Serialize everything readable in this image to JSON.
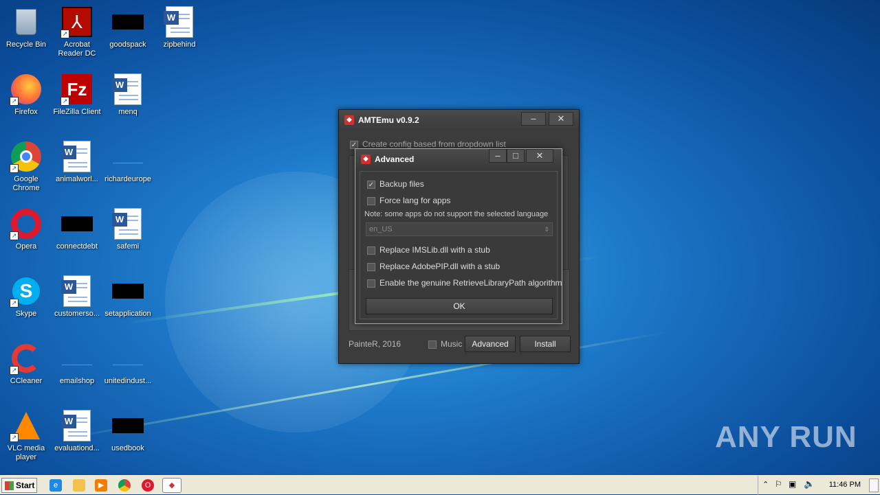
{
  "desktop": {
    "icons": [
      {
        "label": "Recycle Bin"
      },
      {
        "label": "Acrobat Reader DC"
      },
      {
        "label": "goodspack"
      },
      {
        "label": "zipbehind"
      },
      {
        "label": "Firefox"
      },
      {
        "label": "FileZilla Client"
      },
      {
        "label": "menq"
      },
      {
        "label": "Google Chrome"
      },
      {
        "label": "animalworl..."
      },
      {
        "label": "richardeurope"
      },
      {
        "label": "Opera"
      },
      {
        "label": "connectdebt"
      },
      {
        "label": "safemi"
      },
      {
        "label": "Skype"
      },
      {
        "label": "customerso..."
      },
      {
        "label": "setapplication"
      },
      {
        "label": "CCleaner"
      },
      {
        "label": "emailshop"
      },
      {
        "label": "unitedindust..."
      },
      {
        "label": "VLC media player"
      },
      {
        "label": "evaluationd..."
      },
      {
        "label": "usedbook"
      }
    ],
    "watermark": "ANY RUN"
  },
  "main_window": {
    "title": "AMTEmu v0.9.2",
    "create_config_label": "Create config based from dropdown list",
    "footer_text": "PainteR, 2016",
    "music_label": "Music",
    "advanced_button": "Advanced",
    "install_button": "Install"
  },
  "advanced_dialog": {
    "title": "Advanced",
    "backup_files": "Backup files",
    "force_lang": "Force lang for apps",
    "note": "Note: some apps do not support the selected language",
    "language_value": "en_US",
    "replace_imslib": "Replace IMSLib.dll with a stub",
    "replace_adobepip": "Replace AdobePIP.dll with a stub",
    "enable_retrieve": "Enable the genuine RetrieveLibraryPath algorithm",
    "ok_button": "OK"
  },
  "taskbar": {
    "start_label": "Start",
    "clock": "11:46 PM"
  }
}
